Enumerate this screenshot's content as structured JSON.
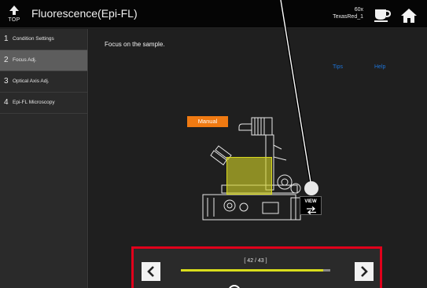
{
  "header": {
    "top_label": "TOP",
    "title": "Fluorescence(Epi-FL)",
    "objective": "60x",
    "filter": "TexasRed_1"
  },
  "sidebar": {
    "items": [
      {
        "num": "1",
        "label": "Condition Settings",
        "active": false
      },
      {
        "num": "2",
        "label": "Focus Adj.",
        "active": true
      },
      {
        "num": "3",
        "label": "Optical Axis Adj.",
        "active": false
      },
      {
        "num": "4",
        "label": "Epi-FL Microscopy",
        "active": false
      }
    ]
  },
  "main": {
    "instruction": "Focus on the sample.",
    "tips": "Tips",
    "help": "Help",
    "mode_badge": "Manual",
    "view_label": "VIEW"
  },
  "navigation": {
    "step_text": "[ 42 / 43 ]",
    "progress": 0.95
  },
  "colors": {
    "accent_orange": "#f07a12",
    "highlight_yellow": "#d8d820",
    "link_blue": "#1e74d8",
    "frame_red": "#e0001b"
  },
  "icons": {
    "top": "arrow-up-icon",
    "cup": "coffee-cup-icon",
    "home": "home-icon",
    "view": "swap-arrows-icon",
    "prev": "chevron-left-icon",
    "next": "chevron-right-icon"
  }
}
